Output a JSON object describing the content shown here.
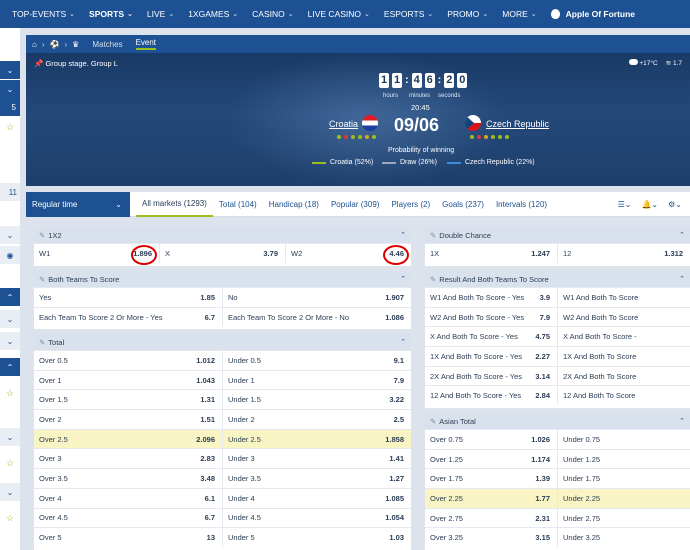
{
  "nav": {
    "items": [
      {
        "label": "TOP-EVENTS",
        "chev": true
      },
      {
        "label": "SPORTS",
        "chev": true,
        "active": true
      },
      {
        "label": "LIVE",
        "chev": true
      },
      {
        "label": "1XGAMES",
        "chev": true
      },
      {
        "label": "CASINO",
        "chev": true
      },
      {
        "label": "LIVE CASINO",
        "chev": true
      },
      {
        "label": "ESPORTS",
        "chev": true
      },
      {
        "label": "PROMO",
        "chev": true
      },
      {
        "label": "MORE",
        "chev": true
      }
    ],
    "apple_label": "Apple Of Fortune"
  },
  "left": {
    "badge1": "5",
    "badge2": "11"
  },
  "breadcrumb": {
    "tabs": [
      "Matches",
      "Event"
    ]
  },
  "event": {
    "group": "Group stage. Group L",
    "weather_temp": "+17°C",
    "wind": "1.7",
    "timer_digits": [
      "1",
      "1",
      "4",
      "6",
      "2",
      "0"
    ],
    "labels": {
      "hours": "hours",
      "minutes": "minutes",
      "seconds": "seconds"
    },
    "kickoff": "20:45",
    "date": "09/06",
    "home": "Croatia",
    "away": "Czech Republic",
    "probability_title": "Probability of winning",
    "prob": [
      {
        "label": "Croatia (52%)",
        "color": "#9bbe1e"
      },
      {
        "label": "Draw (26%)",
        "color": "#9aa9bb"
      },
      {
        "label": "Czech Republic (22%)",
        "color": "#3b8de0"
      }
    ],
    "home_dots": [
      "#9bbe1e",
      "#e03838",
      "#9bbe1e",
      "#9bbe1e",
      "#e0a020",
      "#9bbe1e"
    ],
    "away_dots": [
      "#9bbe1e",
      "#e03838",
      "#e0a020",
      "#9bbe1e",
      "#9bbe1e",
      "#9bbe1e"
    ]
  },
  "filters": {
    "period": "Regular time",
    "tabs": [
      "All markets (1293)",
      "Total (104)",
      "Handicap (18)",
      "Popular (309)",
      "Players (2)",
      "Goals (237)",
      "Intervals (120)"
    ]
  },
  "markets": {
    "m1x2": {
      "title": "1X2",
      "rows": [
        [
          {
            "l": "W1",
            "v": "1.896"
          },
          {
            "l": "X",
            "v": "3.79"
          },
          {
            "l": "W2",
            "v": "4.46"
          }
        ]
      ]
    },
    "btts": {
      "title": "Both Teams To Score",
      "rows": [
        [
          {
            "l": "Yes",
            "v": "1.85"
          },
          {
            "l": "No",
            "v": "1.907"
          }
        ],
        [
          {
            "l": "Each Team To Score 2 Or More - Yes",
            "v": "6.7"
          },
          {
            "l": "Each Team To Score 2 Or More - No",
            "v": "1.086"
          }
        ]
      ]
    },
    "total": {
      "title": "Total",
      "rows": [
        [
          {
            "l": "Over 0.5",
            "v": "1.012"
          },
          {
            "l": "Under 0.5",
            "v": "9.1"
          }
        ],
        [
          {
            "l": "Over 1",
            "v": "1.043"
          },
          {
            "l": "Under 1",
            "v": "7.9"
          }
        ],
        [
          {
            "l": "Over 1.5",
            "v": "1.31"
          },
          {
            "l": "Under 1.5",
            "v": "3.22"
          }
        ],
        [
          {
            "l": "Over 2",
            "v": "1.51"
          },
          {
            "l": "Under 2",
            "v": "2.5"
          }
        ],
        [
          {
            "l": "Over 2.5",
            "v": "2.096"
          },
          {
            "l": "Under 2.5",
            "v": "1.858"
          }
        ],
        [
          {
            "l": "Over 3",
            "v": "2.83"
          },
          {
            "l": "Under 3",
            "v": "1.41"
          }
        ],
        [
          {
            "l": "Over 3.5",
            "v": "3.48"
          },
          {
            "l": "Under 3.5",
            "v": "1.27"
          }
        ],
        [
          {
            "l": "Over 4",
            "v": "6.1"
          },
          {
            "l": "Under 4",
            "v": "1.085"
          }
        ],
        [
          {
            "l": "Over 4.5",
            "v": "6.7"
          },
          {
            "l": "Under 4.5",
            "v": "1.054"
          }
        ],
        [
          {
            "l": "Over 5",
            "v": "13"
          },
          {
            "l": "Under 5",
            "v": "1.03"
          }
        ]
      ]
    },
    "dc": {
      "title": "Double Chance",
      "rows": [
        [
          {
            "l": "1X",
            "v": "1.247"
          },
          {
            "l": "12",
            "v": "1.312"
          }
        ]
      ]
    },
    "rbtts": {
      "title": "Result And Both Teams To Score",
      "rows": [
        [
          {
            "l": "W1 And Both To Score - Yes",
            "v": "3.9"
          },
          {
            "l": "W1 And Both To Score",
            "v": ""
          }
        ],
        [
          {
            "l": "W2 And Both To Score - Yes",
            "v": "7.9"
          },
          {
            "l": "W2 And Both To Score",
            "v": ""
          }
        ],
        [
          {
            "l": "X And Both To Score - Yes",
            "v": "4.75"
          },
          {
            "l": "X And Both To Score -",
            "v": ""
          }
        ],
        [
          {
            "l": "1X And Both To Score - Yes",
            "v": "2.27"
          },
          {
            "l": "1X And Both To Score",
            "v": ""
          }
        ],
        [
          {
            "l": "2X And Both To Score - Yes",
            "v": "3.14"
          },
          {
            "l": "2X And Both To Score",
            "v": ""
          }
        ],
        [
          {
            "l": "12 And Both To Score - Yes",
            "v": "2.84"
          },
          {
            "l": "12 And Both To Score",
            "v": ""
          }
        ]
      ]
    },
    "asian": {
      "title": "Asian Total",
      "rows": [
        [
          {
            "l": "Over 0.75",
            "v": "1.026"
          },
          {
            "l": "Under 0.75",
            "v": ""
          }
        ],
        [
          {
            "l": "Over 1.25",
            "v": "1.174"
          },
          {
            "l": "Under 1.25",
            "v": ""
          }
        ],
        [
          {
            "l": "Over 1.75",
            "v": "1.39"
          },
          {
            "l": "Under 1.75",
            "v": ""
          }
        ],
        [
          {
            "l": "Over 2.25",
            "v": "1.77"
          },
          {
            "l": "Under 2.25",
            "v": ""
          }
        ],
        [
          {
            "l": "Over 2.75",
            "v": "2.31"
          },
          {
            "l": "Under 2.75",
            "v": ""
          }
        ],
        [
          {
            "l": "Over 3.25",
            "v": "3.15"
          },
          {
            "l": "Under 3.25",
            "v": ""
          }
        ]
      ]
    }
  }
}
